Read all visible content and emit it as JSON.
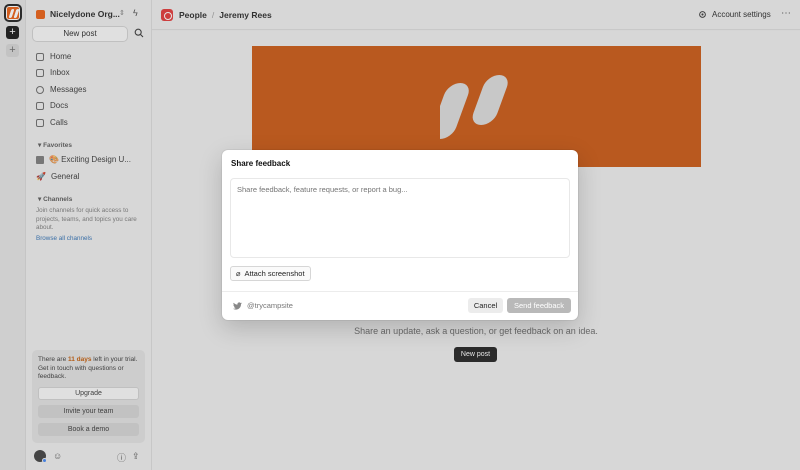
{
  "workspace": {
    "name": "Nicelydone Org..."
  },
  "sidebar": {
    "new_post": "New post",
    "nav": [
      {
        "label": "Home",
        "icon": "home-icon"
      },
      {
        "label": "Inbox",
        "icon": "inbox-icon"
      },
      {
        "label": "Messages",
        "icon": "messages-icon"
      },
      {
        "label": "Docs",
        "icon": "docs-icon"
      },
      {
        "label": "Calls",
        "icon": "calls-icon"
      }
    ],
    "favorites_label": "Favorites",
    "favorites": [
      {
        "label": "🎨 Exciting Design U...",
        "icon": "doc-icon"
      },
      {
        "label": "General",
        "icon": "rocket-icon"
      }
    ],
    "channels_label": "Channels",
    "channels_help": "Join channels for quick access to projects, teams, and topics you care about.",
    "browse_channels": "Browse all channels",
    "trial": {
      "text_before": "There are ",
      "days": "11 days",
      "text_after": " left in your trial. Get in touch with questions or feedback.",
      "upgrade": "Upgrade",
      "invite": "Invite your team",
      "demo": "Book a demo"
    }
  },
  "header": {
    "crumb_1": "People",
    "separator": "/",
    "crumb_2": "Jeremy Rees",
    "account_settings": "Account settings"
  },
  "main": {
    "empty_subtitle": "Share an update, ask a question, or get feedback on an idea.",
    "empty_button": "New post"
  },
  "modal": {
    "title": "Share feedback",
    "placeholder": "Share feedback, feature requests, or report a bug...",
    "attach": "Attach screenshot",
    "twitter_handle": "@trycampsite",
    "cancel": "Cancel",
    "send": "Send feedback"
  },
  "colors": {
    "brand": "#e8590c",
    "hero": "#c7520c",
    "trial_highlight": "#c05600",
    "link": "#2b6cb0"
  }
}
